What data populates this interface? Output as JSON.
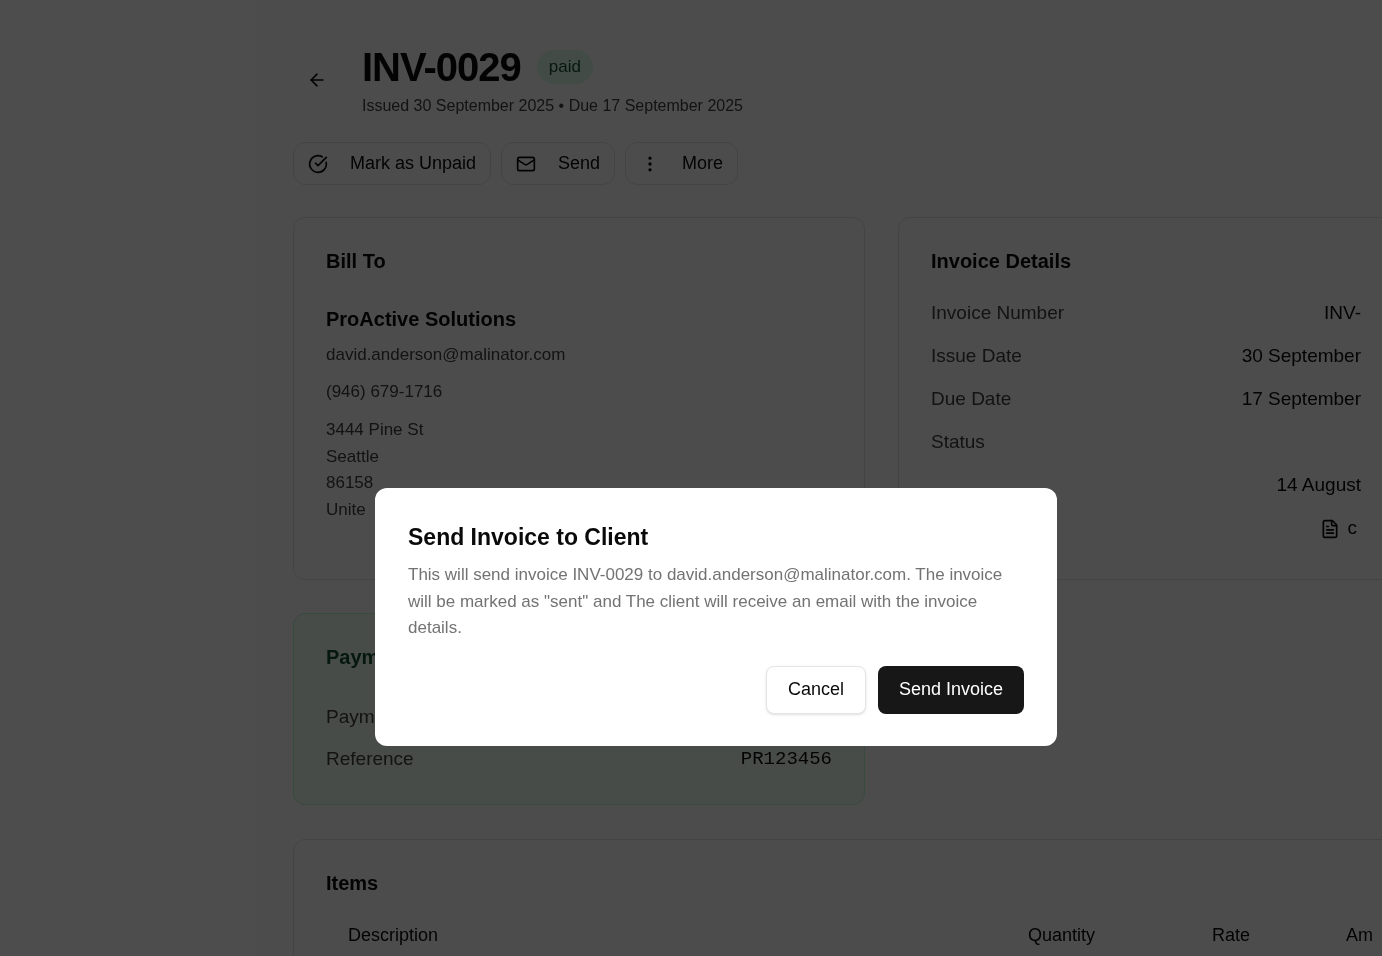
{
  "header": {
    "title": "INV-0029",
    "status": "paid",
    "subtitle": "Issued 30 September 2025 • Due 17 September 2025"
  },
  "actions": [
    {
      "label": "Mark as Unpaid",
      "kind": "check"
    },
    {
      "label": "Send",
      "kind": "mail"
    },
    {
      "label": "More",
      "kind": "more"
    }
  ],
  "bill_to": {
    "heading": "Bill To",
    "name": "ProActive Solutions",
    "email": "david.anderson@malinator.com",
    "phone": "(946) 679-1716",
    "address": [
      "3444 Pine St",
      "Seattle",
      "86158",
      "Unite"
    ]
  },
  "invoice_details": {
    "heading": "Invoice Details",
    "rows": [
      {
        "label": "Invoice Number",
        "value": "INV-"
      },
      {
        "label": "Issue Date",
        "value": "30 September"
      },
      {
        "label": "Due Date",
        "value": "17 September"
      },
      {
        "label": "Status"
      },
      {
        "value": "14 August"
      }
    ],
    "attachment": "c"
  },
  "payment": {
    "heading": "Paym",
    "rows": [
      {
        "label": "Paym"
      },
      {
        "label": "Reference",
        "value": "PR123456"
      }
    ]
  },
  "items": {
    "heading": "Items",
    "columns": [
      "Description",
      "Quantity",
      "Rate",
      "Am"
    ]
  },
  "dialog": {
    "title": "Send Invoice to Client",
    "message": "This will send invoice INV-0029 to david.anderson@malinator.com. The invoice will be marked as \"sent\" and The client will receive an email with the invoice details.",
    "buttons": [
      {
        "label": "Cancel",
        "kind": "secondary"
      },
      {
        "label": "Send Invoice",
        "kind": "primary"
      }
    ]
  }
}
